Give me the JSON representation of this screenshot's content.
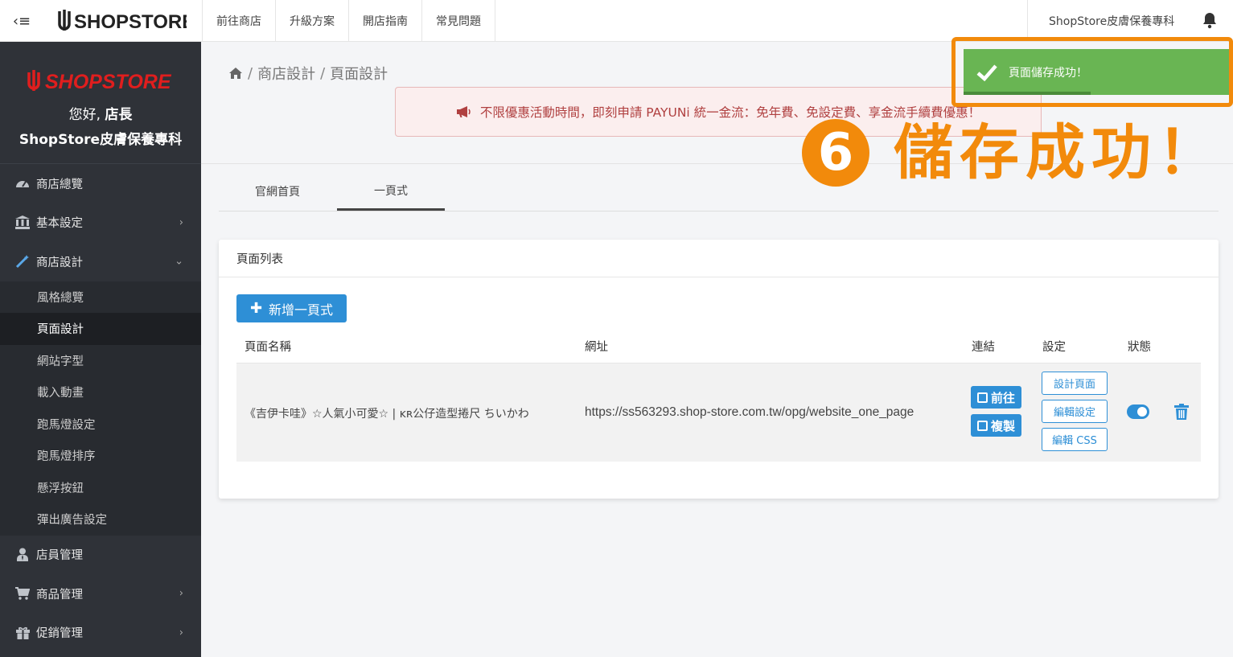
{
  "topbar": {
    "logo_text": "SHOPSTORE",
    "nav": [
      "前往商店",
      "升級方案",
      "開店指南",
      "常見問題"
    ],
    "store_name": "ShopStore皮膚保養專科"
  },
  "sidebar": {
    "logo_text": "SHOPSTORE",
    "greeting_prefix": "您好,",
    "greeting_role": "店長",
    "store_name": "ShopStore皮膚保養專科",
    "items": [
      {
        "label": "商店總覽",
        "icon": "dashboard-icon"
      },
      {
        "label": "基本設定",
        "icon": "bank-icon"
      },
      {
        "label": "商店設計",
        "icon": "magic-wand-icon"
      }
    ],
    "subitems": [
      "風格總覽",
      "頁面設計",
      "網站字型",
      "載入動畫",
      "跑馬燈設定",
      "跑馬燈排序",
      "懸浮按鈕",
      "彈出廣告設定"
    ],
    "items_after": [
      {
        "label": "店員管理",
        "icon": "user-tie-icon"
      },
      {
        "label": "商品管理",
        "icon": "cart-icon"
      },
      {
        "label": "促銷管理",
        "icon": "gift-icon"
      }
    ]
  },
  "breadcrumb": {
    "level1": "商店設計",
    "level2": "頁面設計"
  },
  "promo": {
    "text": "不限優惠活動時間，即刻申請 PAYUNi 統一金流：免年費、免設定費、享金流手續費優惠！"
  },
  "tabs": [
    "官網首頁",
    "一頁式"
  ],
  "card": {
    "title": "頁面列表",
    "add_button": "新增一頁式",
    "columns": [
      "頁面名稱",
      "網址",
      "連結",
      "設定",
      "狀態"
    ],
    "rows": [
      {
        "name": "《吉伊卡哇》☆人氣小可愛☆ | ᴋʀ公仔造型捲尺 ちいかわ",
        "url": "https://ss563293.shop-store.com.tw/opg/website_one_page",
        "link_go": "前往",
        "link_copy": "複製",
        "btn_design": "設計頁面",
        "btn_edit": "編輯設定",
        "btn_css": "編輯 CSS",
        "status": true
      }
    ]
  },
  "toast": {
    "message": "頁面儲存成功！",
    "progress": 0.48
  },
  "annotation": {
    "number": "6",
    "text": "儲存成功！"
  },
  "colors": {
    "accent": "#2e8fd6",
    "success": "#69b553",
    "annotation": "#f28a0b",
    "sidebar_bg": "#2f3238"
  }
}
